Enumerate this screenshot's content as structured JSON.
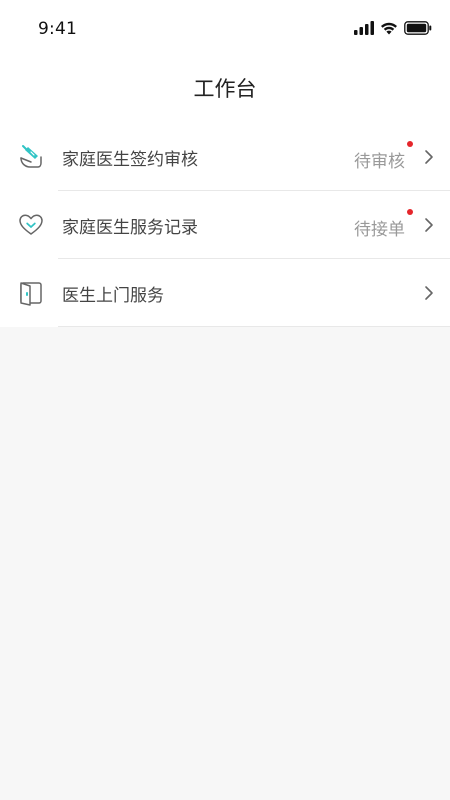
{
  "status_bar": {
    "time": "9:41",
    "icons": [
      "signal-icon",
      "wifi-icon",
      "battery-icon"
    ]
  },
  "header": {
    "title": "工作台"
  },
  "menu": {
    "items": [
      {
        "label": "家庭医生签约审核",
        "status": "待审核",
        "has_dot": true,
        "icon": "signing-icon"
      },
      {
        "label": "家庭医生服务记录",
        "status": "待接单",
        "has_dot": true,
        "icon": "heart-icon"
      },
      {
        "label": "医生上门服务",
        "status": "",
        "has_dot": false,
        "icon": "door-icon"
      }
    ]
  },
  "colors": {
    "accent": "#31c4c5",
    "dot": "#e5262b",
    "background": "#f7f7f7"
  }
}
